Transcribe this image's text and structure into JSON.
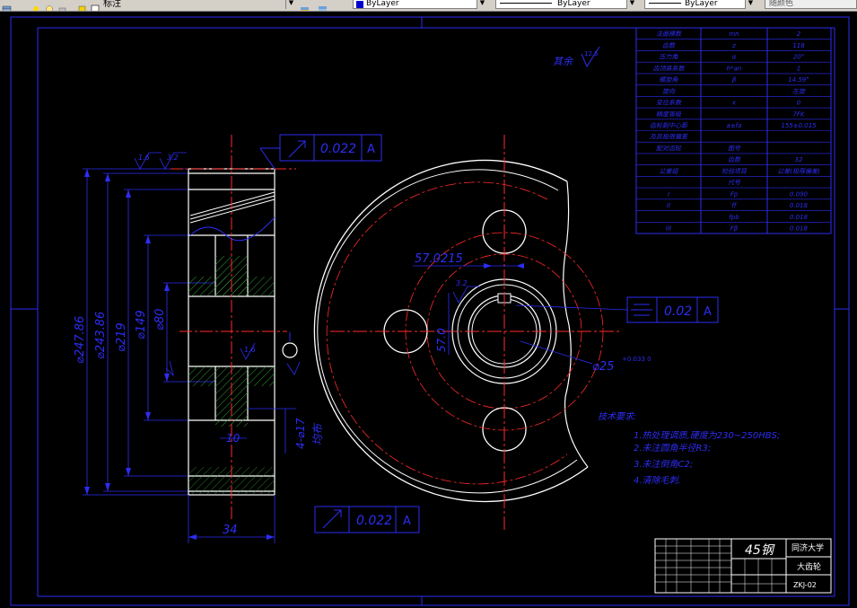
{
  "toolbar": {
    "layer_name": "标注",
    "color_value": "ByLayer",
    "linetype_value": "ByLayer",
    "lineweight_value": "ByLayer",
    "plotstyle_value": "随颜色"
  },
  "drawing": {
    "roughness_note": "其余",
    "roughness_main": "12.5",
    "roughness_top_1": "1.6",
    "roughness_top_2": "3.2",
    "roughness_bore": "3.2",
    "roughness_hub_1": "1.6",
    "roughness_hub_2": "3.2",
    "roughness_hub_3": "3.2",
    "tolerance_top": {
      "value": "0.022",
      "datum": "A"
    },
    "tolerance_bottom": {
      "value": "0.022",
      "datum": "A"
    },
    "tolerance_right": {
      "value": "0.02",
      "datum": "A"
    },
    "dims": {
      "d_outer": "⌀247.86",
      "d_pitch": "⌀243.86",
      "d_root": "⌀219",
      "d_hub": "⌀149",
      "d_web": "⌀80",
      "d_hole": "⌀17",
      "hole_count": "4-⌀17",
      "even": "均布",
      "web_thk": "10",
      "width": "34",
      "keyway_w": "57.0215",
      "keyway_h": "57.0",
      "bore": "⌀25",
      "bore_tol": "+0.033 0"
    },
    "tech_requirements": {
      "title": "技术要求:",
      "items": [
        "1.热处理调质,硬度为230~250HBS;",
        "2.未注圆角半径R3;",
        "3.未注倒角C2;",
        "4.清除毛刺."
      ]
    },
    "param_table": {
      "rows": [
        [
          "法面模数",
          "mn",
          "2"
        ],
        [
          "齿数",
          "z",
          "118"
        ],
        [
          "压力角",
          "α",
          "20°"
        ],
        [
          "齿顶高系数",
          "h*an",
          "1"
        ],
        [
          "螺旋角",
          "β",
          "14.59°"
        ],
        [
          "旋向",
          "",
          "左旋"
        ],
        [
          "变位系数",
          "x",
          "0"
        ],
        [
          "精度等级",
          "",
          "7FK"
        ],
        [
          "齿轮副中心距",
          "a±fa",
          "155±0.015"
        ],
        [
          "及其极限偏差",
          "",
          ""
        ],
        [
          "配对齿轮",
          "图号",
          ""
        ],
        [
          "",
          "齿数",
          "32"
        ],
        [
          "公差组",
          "检验项目",
          "公差(极限偏差)"
        ],
        [
          "",
          "代号",
          ""
        ],
        [
          "I",
          "Fp",
          "0.090"
        ],
        [
          "II",
          "ff",
          "0.018"
        ],
        [
          "",
          "fpb",
          "0.018"
        ],
        [
          "III",
          "Fβ",
          "0.018"
        ]
      ]
    },
    "title_block": {
      "material": "45钢",
      "school": "同济大学",
      "part_name": "大齿轮",
      "drawing_no": "ZKJ-02"
    }
  },
  "colors": {
    "background": "#000000",
    "dimension_blue": "#2d2df5",
    "center_red": "#ff2a2a",
    "outline_white": "#ffffff",
    "hatch_green": "#2fa02f"
  }
}
